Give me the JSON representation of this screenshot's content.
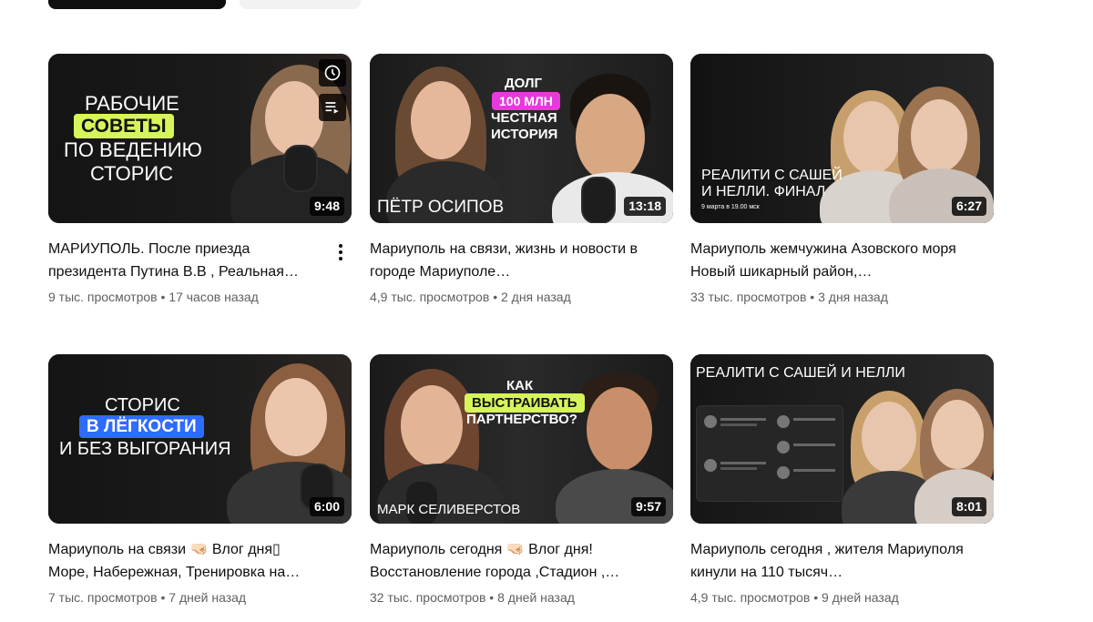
{
  "videos": [
    {
      "thumb_lines": [
        "РАБОЧИЕ",
        "СОВЕТЫ",
        "ПО ВЕДЕНИЮ",
        "СТОРИС"
      ],
      "duration": "9:48",
      "title": "МАРИУПОЛЬ. После приезда президента Путина В.В , Реальная…",
      "views": "9 тыс. просмотров",
      "age": "17 часов назад"
    },
    {
      "thumb_lines": [
        "ДОЛГ",
        "100 МЛН",
        "ЧЕСТНАЯ",
        "ИСТОРИЯ"
      ],
      "name_caption": "ПЁТР ОСИПОВ",
      "duration": "13:18",
      "title": "Мариуполь на связи, жизнь и новости в городе Мариуполе…",
      "views": "4,9 тыс. просмотров",
      "age": "2 дня назад"
    },
    {
      "thumb_lines": [
        "РЕАЛИТИ С САШЕЙ",
        "И НЕЛЛИ. ФИНАЛ",
        "9 марта в 19.00 мск"
      ],
      "duration": "6:27",
      "title": "Мариуполь жемчужина Азовского моря Новый шикарный район,…",
      "views": "33 тыс. просмотров",
      "age": "3 дня назад"
    },
    {
      "thumb_lines": [
        "СТОРИС",
        "В ЛЁГКОСТИ",
        "И БЕЗ ВЫГОРАНИЯ"
      ],
      "duration": "6:00",
      "title": "Мариуполь на связи 🤜🏻 Влог дня▯ Море, Набережная, Тренировка на…",
      "views": "7 тыс. просмотров",
      "age": "7 дней назад"
    },
    {
      "thumb_lines": [
        "КАК",
        "ВЫСТРАИВАТЬ",
        "ПАРТНЕРСТВО?"
      ],
      "name_caption": "МАРК СЕЛИВЕРСТОВ",
      "duration": "9:57",
      "title": "Мариуполь сегодня 🤜🏻 Влог дня! Восстановление города ,Стадион ,…",
      "views": "32 тыс. просмотров",
      "age": "8 дней назад"
    },
    {
      "thumb_lines": [
        "РЕАЛИТИ С САШЕЙ И НЕЛЛИ"
      ],
      "duration": "8:01",
      "title": "Мариуполь сегодня , жителя Мариуполя кинули на 110 тысяч…",
      "views": "4,9 тыс. просмотров",
      "age": "9 дней назад"
    }
  ],
  "meta_separator": "•",
  "icons": {
    "watch_later": "clock-icon",
    "add_to_queue": "queue-icon",
    "more": "more-vert-icon"
  },
  "colors": {
    "highlight_green": "#d6f55a",
    "highlight_pink": "#e63ad9",
    "highlight_blue": "#2e6bff",
    "meta_text": "#606060",
    "title_text": "#0f0f0f"
  }
}
